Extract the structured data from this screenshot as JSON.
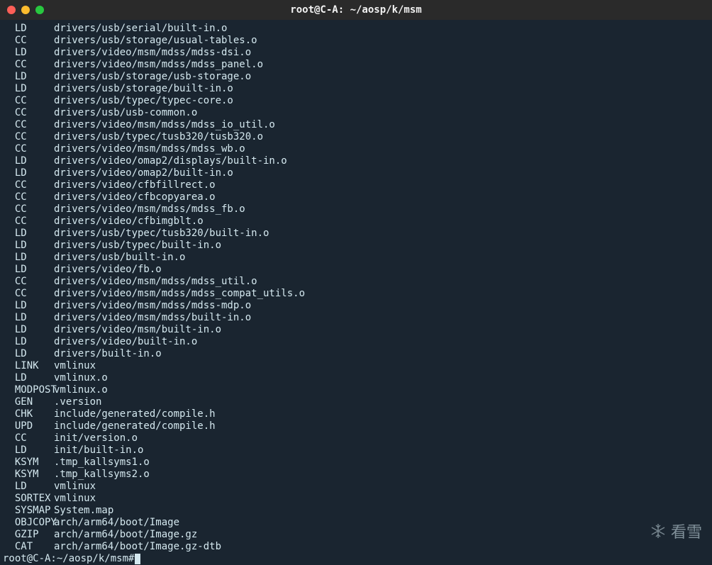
{
  "window": {
    "title": "root@C-A: ~/aosp/k/msm"
  },
  "lines": [
    {
      "cmd": "LD",
      "path": "drivers/usb/serial/built-in.o"
    },
    {
      "cmd": "CC",
      "path": "drivers/usb/storage/usual-tables.o"
    },
    {
      "cmd": "LD",
      "path": "drivers/video/msm/mdss/mdss-dsi.o"
    },
    {
      "cmd": "CC",
      "path": "drivers/video/msm/mdss/mdss_panel.o"
    },
    {
      "cmd": "LD",
      "path": "drivers/usb/storage/usb-storage.o"
    },
    {
      "cmd": "LD",
      "path": "drivers/usb/storage/built-in.o"
    },
    {
      "cmd": "CC",
      "path": "drivers/usb/typec/typec-core.o"
    },
    {
      "cmd": "CC",
      "path": "drivers/usb/usb-common.o"
    },
    {
      "cmd": "CC",
      "path": "drivers/video/msm/mdss/mdss_io_util.o"
    },
    {
      "cmd": "CC",
      "path": "drivers/usb/typec/tusb320/tusb320.o"
    },
    {
      "cmd": "CC",
      "path": "drivers/video/msm/mdss/mdss_wb.o"
    },
    {
      "cmd": "LD",
      "path": "drivers/video/omap2/displays/built-in.o"
    },
    {
      "cmd": "LD",
      "path": "drivers/video/omap2/built-in.o"
    },
    {
      "cmd": "CC",
      "path": "drivers/video/cfbfillrect.o"
    },
    {
      "cmd": "CC",
      "path": "drivers/video/cfbcopyarea.o"
    },
    {
      "cmd": "CC",
      "path": "drivers/video/msm/mdss/mdss_fb.o"
    },
    {
      "cmd": "CC",
      "path": "drivers/video/cfbimgblt.o"
    },
    {
      "cmd": "LD",
      "path": "drivers/usb/typec/tusb320/built-in.o"
    },
    {
      "cmd": "LD",
      "path": "drivers/usb/typec/built-in.o"
    },
    {
      "cmd": "LD",
      "path": "drivers/usb/built-in.o"
    },
    {
      "cmd": "LD",
      "path": "drivers/video/fb.o"
    },
    {
      "cmd": "CC",
      "path": "drivers/video/msm/mdss/mdss_util.o"
    },
    {
      "cmd": "CC",
      "path": "drivers/video/msm/mdss/mdss_compat_utils.o"
    },
    {
      "cmd": "LD",
      "path": "drivers/video/msm/mdss/mdss-mdp.o"
    },
    {
      "cmd": "LD",
      "path": "drivers/video/msm/mdss/built-in.o"
    },
    {
      "cmd": "LD",
      "path": "drivers/video/msm/built-in.o"
    },
    {
      "cmd": "LD",
      "path": "drivers/video/built-in.o"
    },
    {
      "cmd": "LD",
      "path": "drivers/built-in.o"
    },
    {
      "cmd": "LINK",
      "path": "vmlinux"
    },
    {
      "cmd": "LD",
      "path": "vmlinux.o"
    },
    {
      "cmd": "MODPOST",
      "path": "vmlinux.o"
    },
    {
      "cmd": "GEN",
      "path": ".version"
    },
    {
      "cmd": "CHK",
      "path": "include/generated/compile.h"
    },
    {
      "cmd": "UPD",
      "path": "include/generated/compile.h"
    },
    {
      "cmd": "CC",
      "path": "init/version.o"
    },
    {
      "cmd": "LD",
      "path": "init/built-in.o"
    },
    {
      "cmd": "KSYM",
      "path": ".tmp_kallsyms1.o"
    },
    {
      "cmd": "KSYM",
      "path": ".tmp_kallsyms2.o"
    },
    {
      "cmd": "LD",
      "path": "vmlinux"
    },
    {
      "cmd": "SORTEX",
      "path": "vmlinux"
    },
    {
      "cmd": "SYSMAP",
      "path": "System.map"
    },
    {
      "cmd": "OBJCOPY",
      "path": "arch/arm64/boot/Image"
    },
    {
      "cmd": "GZIP",
      "path": "arch/arm64/boot/Image.gz"
    },
    {
      "cmd": "CAT",
      "path": "arch/arm64/boot/Image.gz-dtb"
    }
  ],
  "prompt": "root@C-A:~/aosp/k/msm#",
  "watermark": "看雪"
}
